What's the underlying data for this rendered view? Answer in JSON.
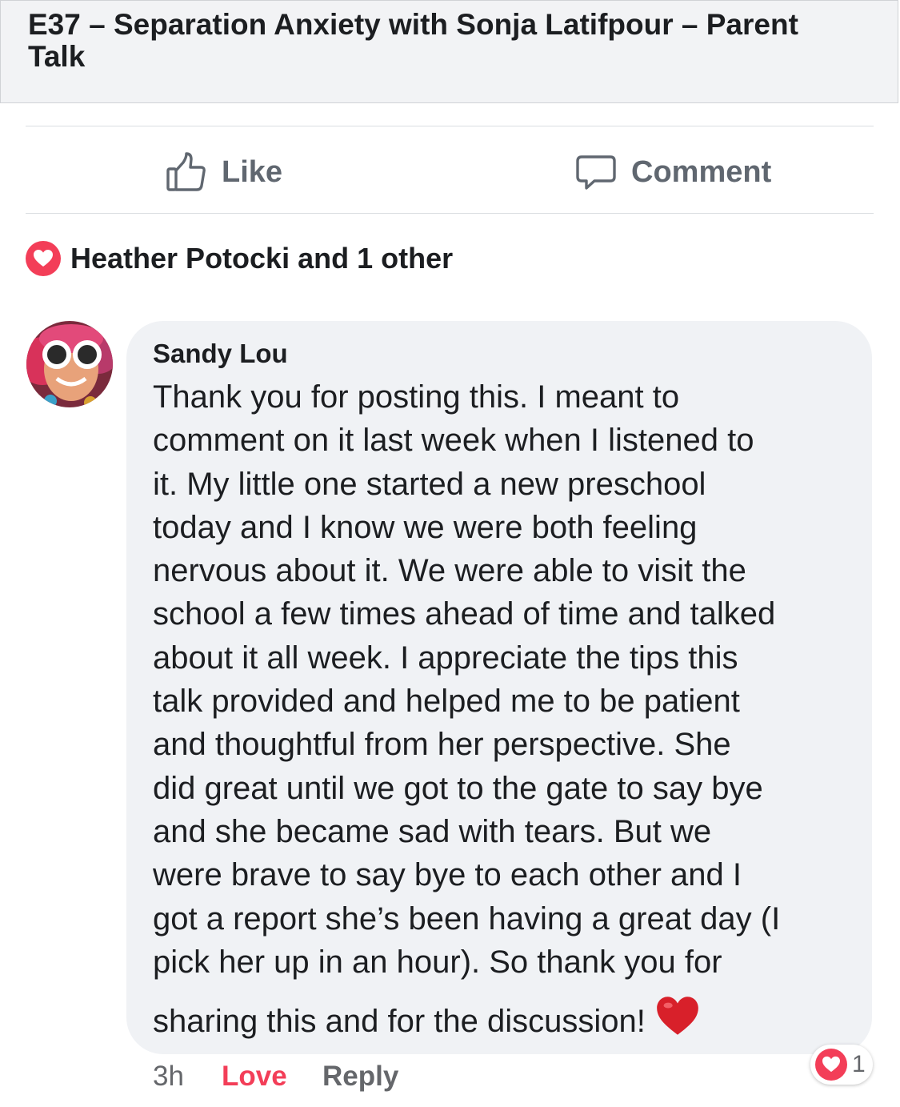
{
  "link_preview": {
    "title": "E37 – Separation Anxiety with Sonja Latifpour – Parent Talk"
  },
  "actions": {
    "like_label": "Like",
    "comment_label": "Comment"
  },
  "reactions_summary": {
    "text": "Heather Potocki and 1 other"
  },
  "comment": {
    "author": "Sandy Lou",
    "lines": [
      "Thank you for posting this. I meant to",
      "comment on it last week when I listened to",
      "it. My little one started a new preschool",
      "today and I know we were both feeling",
      "nervous about it. We were able to visit the",
      "school a few times ahead of time and talked",
      "about it all week. I appreciate the tips this",
      "talk provided and helped me to be patient",
      "and thoughtful from her perspective. She",
      "did great until we got to the gate to say bye",
      "and she became sad with tears. But we",
      "were brave to say bye to each other and I",
      "got a report she’s been having a great day (I",
      "pick her up in an hour). So thank you for"
    ],
    "last_line": "sharing this and for the discussion!",
    "emoji": "red-heart-emoji",
    "time": "3h",
    "love_label": "Love",
    "reply_label": "Reply",
    "reaction_count": "1"
  },
  "colors": {
    "love_red": "#f33e58",
    "bubble_bg": "#f0f2f5",
    "preview_bg": "#f2f3f5",
    "muted_text": "#65676b"
  },
  "icons": [
    "thumbs-up-icon",
    "comment-bubble-icon",
    "heart-reaction-icon",
    "red-heart-emoji"
  ]
}
